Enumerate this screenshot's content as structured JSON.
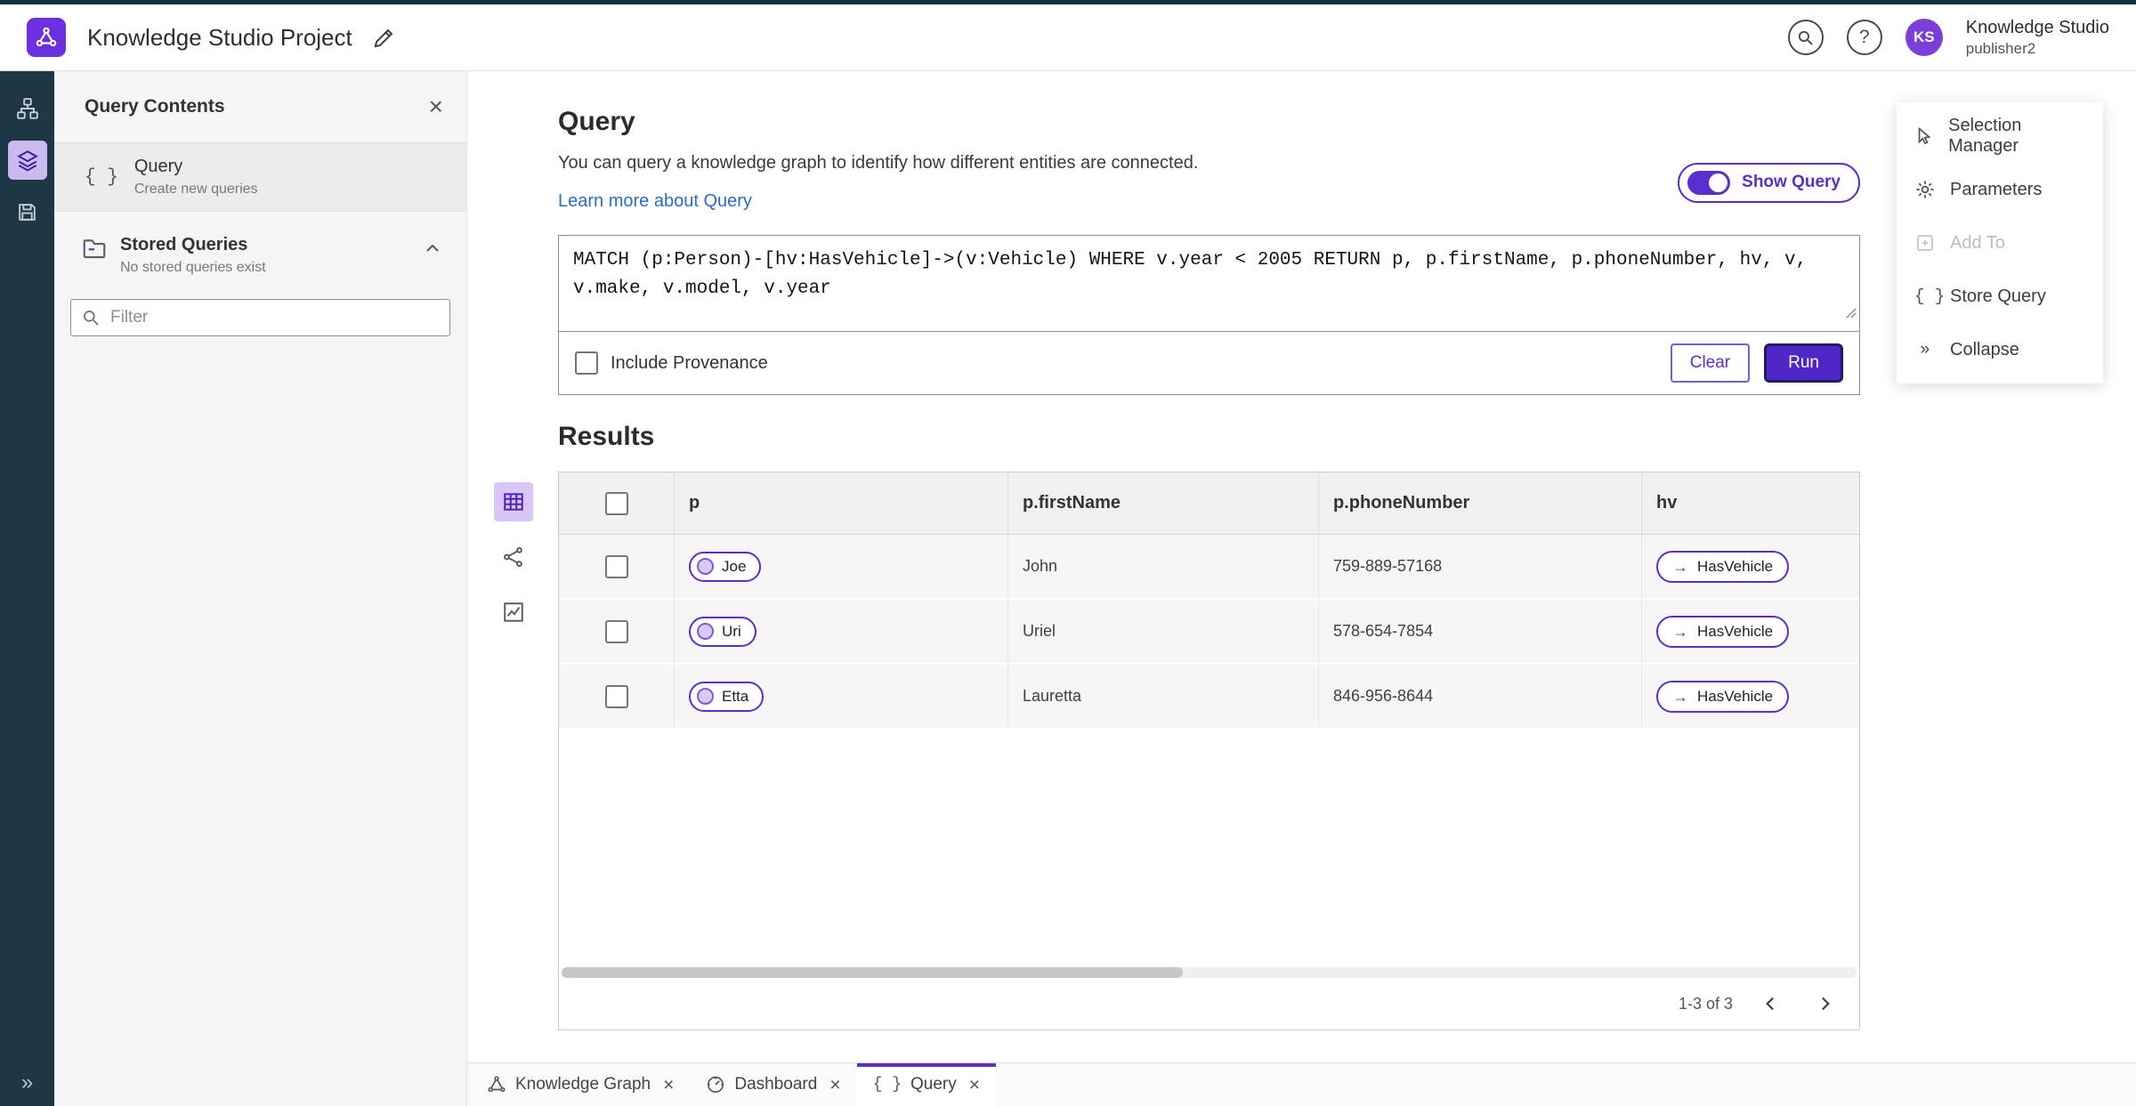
{
  "app": {
    "project_title": "Knowledge Studio Project",
    "brand": "Knowledge Studio",
    "user": "publisher2",
    "avatar_initials": "KS",
    "help_glyph": "?"
  },
  "sidebar": {
    "title": "Query Contents",
    "query_item": {
      "label": "Query",
      "sublabel": "Create new queries"
    },
    "stored_queries": {
      "label": "Stored Queries",
      "sublabel": "No stored queries exist"
    },
    "filter_placeholder": "Filter"
  },
  "query_panel": {
    "title": "Query",
    "description": "You can query a knowledge graph to identify how different entities are connected.",
    "learn_more_link": "Learn more about Query",
    "show_query_label": "Show Query",
    "query_text": "MATCH (p:Person)-[hv:HasVehicle]->(v:Vehicle) WHERE v.year < 2005 RETURN p, p.firstName, p.phoneNumber, hv, v, v.make, v.model, v.year",
    "include_provenance_label": "Include Provenance",
    "clear_button": "Clear",
    "run_button": "Run"
  },
  "results": {
    "title": "Results",
    "columns": {
      "p": "p",
      "first_name": "p.firstName",
      "phone": "p.phoneNumber",
      "hv": "hv"
    },
    "rows": [
      {
        "p": "Joe",
        "firstName": "John",
        "phone": "759-889-57168",
        "hv": "HasVehicle"
      },
      {
        "p": "Uri",
        "firstName": "Uriel",
        "phone": "578-654-7854",
        "hv": "HasVehicle"
      },
      {
        "p": "Etta",
        "firstName": "Lauretta",
        "phone": "846-956-8644",
        "hv": "HasVehicle"
      }
    ],
    "pagination": "1-3 of 3"
  },
  "context_menu": {
    "selection_manager": "Selection Manager",
    "parameters": "Parameters",
    "add_to": "Add To",
    "store_query": "Store Query",
    "collapse": "Collapse"
  },
  "tabs": [
    {
      "label": "Knowledge Graph"
    },
    {
      "label": "Dashboard"
    },
    {
      "label": "Query"
    }
  ],
  "colors": {
    "primary_purple": "#5b2ecc",
    "run_button_purple": "#4f27c8",
    "link_blue": "#2a6bcd",
    "rail_dark": "#1d3844",
    "avatar_purple": "#7c3ed8"
  }
}
